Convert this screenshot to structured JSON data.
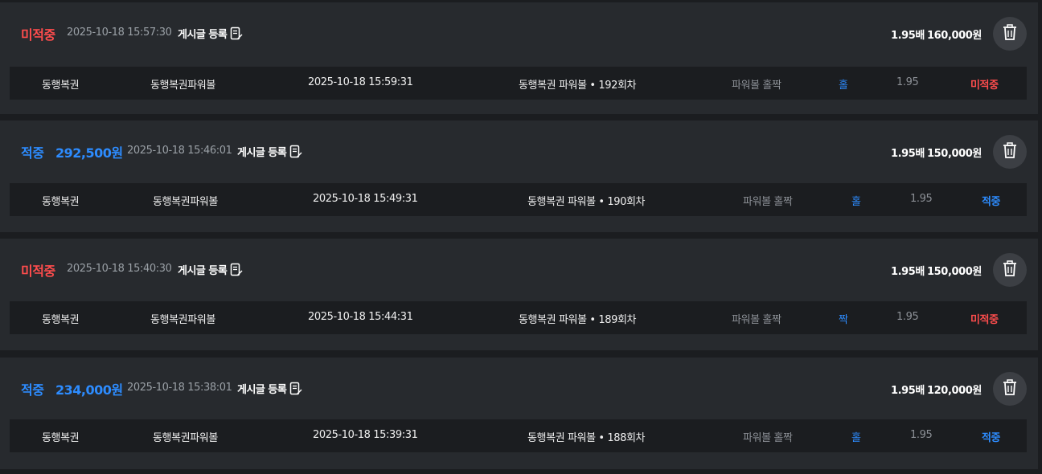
{
  "bets": [
    {
      "status": "미적중",
      "status_type": "lose",
      "payout": "",
      "datetime": "2025-10-18 15:57:30",
      "post_label": "게시글 등록",
      "odds": "1.95배",
      "amount": "160,000원",
      "detail": {
        "provider": "동행복권",
        "game": "동행복권파워볼",
        "draw_time": "2025-10-18 15:59:31",
        "round": "동행복권 파워볼 • 192회차",
        "market": "파워볼 홀짝",
        "pick": "홀",
        "rate": "1.95",
        "result": "미적중"
      }
    },
    {
      "status": "적중",
      "status_type": "win",
      "payout": "292,500원",
      "datetime": "2025-10-18 15:46:01",
      "post_label": "게시글 등록",
      "odds": "1.95배",
      "amount": "150,000원",
      "detail": {
        "provider": "동행복권",
        "game": "동행복권파워볼",
        "draw_time": "2025-10-18 15:49:31",
        "round": "동행복권 파워볼 • 190회차",
        "market": "파워볼 홀짝",
        "pick": "홀",
        "rate": "1.95",
        "result": "적중"
      }
    },
    {
      "status": "미적중",
      "status_type": "lose",
      "payout": "",
      "datetime": "2025-10-18 15:40:30",
      "post_label": "게시글 등록",
      "odds": "1.95배",
      "amount": "150,000원",
      "detail": {
        "provider": "동행복권",
        "game": "동행복권파워볼",
        "draw_time": "2025-10-18 15:44:31",
        "round": "동행복권 파워볼 • 189회차",
        "market": "파워볼 홀짝",
        "pick": "짝",
        "rate": "1.95",
        "result": "미적중"
      }
    },
    {
      "status": "적중",
      "status_type": "win",
      "payout": "234,000원",
      "datetime": "2025-10-18 15:38:01",
      "post_label": "게시글 등록",
      "odds": "1.95배",
      "amount": "120,000원",
      "detail": {
        "provider": "동행복권",
        "game": "동행복권파워볼",
        "draw_time": "2025-10-18 15:39:31",
        "round": "동행복권 파워볼 • 188회차",
        "market": "파워볼 홀짝",
        "pick": "홀",
        "rate": "1.95",
        "result": "적중"
      }
    }
  ],
  "icons": {
    "post": "edit-note-icon",
    "delete": "trash-icon"
  },
  "colors": {
    "win": "#2d8cff",
    "lose": "#ff4d4d",
    "card_bg": "#272a2e",
    "row_bg": "#1b1d20"
  }
}
